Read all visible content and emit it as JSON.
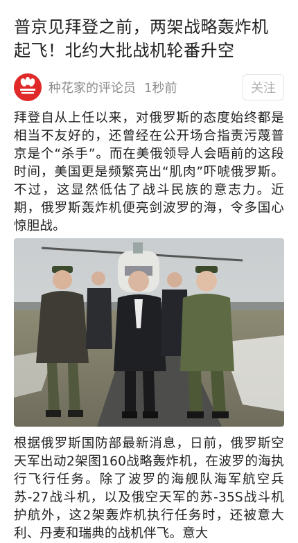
{
  "article": {
    "title": "普京见拜登之前，两架战略轰炸机起飞！北约大批战机轮番升空",
    "author": "种花家的评论员",
    "time": "1秒前",
    "follow_label": "关注",
    "avatar_text": "种花家\n评论员",
    "paragraph1": "拜登自从上任以来，对俄罗斯的态度始终都是相当不友好的，还曾经在公开场合指责污蔑普京是个“杀手”。而在美俄领导人会晤前的这段时间，美国更是频繁亮出“肌肉”吓唬俄罗斯。不过，这显然低估了战斗民族的意志力。近期，俄罗斯轰炸机便亮剑波罗的海，令多国心惊胆战。",
    "paragraph2": "根据俄罗斯国防部最新消息，日前，俄罗斯空天军出动2架图160战略轰炸机，在波罗的海执行飞行任务。除了波罗的海舰队海军航空兵苏-27战斗机，以及俄空天军的苏-35S战斗机护航外，这2架轰炸机执行任务时，还被意大利、丹麦和瑞典的战机伴飞。意大"
  },
  "colors": {
    "brand_red": "#e02a2a",
    "meta_gray": "#8c8c8c",
    "text": "#222222"
  }
}
